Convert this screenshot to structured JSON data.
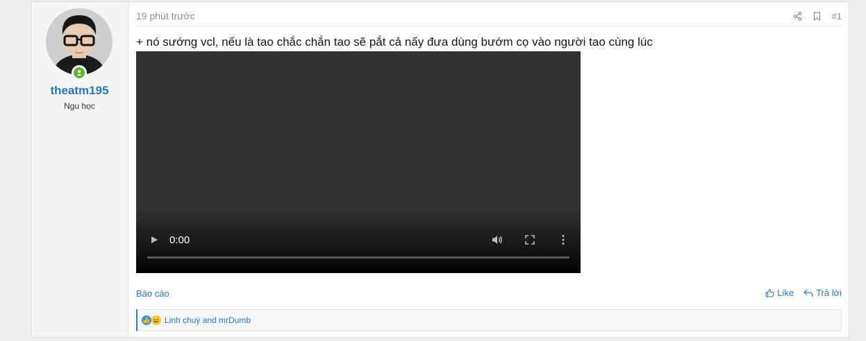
{
  "user": {
    "name": "theatm195",
    "title": "Ngu học",
    "online": true
  },
  "post": {
    "time": "19 phút trước",
    "number": "#1",
    "text": "+ nó sướng vcl, nếu là tao chắc chắn tao sẽ pắt cả nấy đưa dùng bướm cọ vào người tao cùng lúc",
    "video": {
      "time": "0:00",
      "progress": 0
    }
  },
  "actions": {
    "report": "Báo cáo",
    "like": "Like",
    "reply": "Trả lời"
  },
  "reactions": {
    "icons": [
      "like-icon",
      "haha-icon"
    ],
    "text": "Linh chuỳ and mrDumb"
  },
  "colors": {
    "accent": "#2a77b6",
    "online": "#63b132"
  }
}
